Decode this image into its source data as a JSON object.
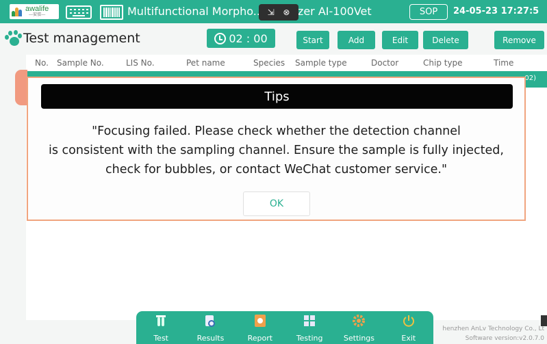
{
  "colors": {
    "accent": "#2ab091",
    "dialog_border": "#f0a47e",
    "dialog_header": "#050505",
    "scroll_tab": "#f19a80"
  },
  "titlebar": {
    "logo_text": "awalife",
    "logo_subtext": "—安驭—",
    "app_title": "Multifunctional Morpho... Analyzer AI-100Vet",
    "sop_label": "SOP",
    "datetime": "24-05-23 17:27:5"
  },
  "header": {
    "title": "Test management",
    "timer": "02 : 00",
    "buttons": {
      "start": "Start",
      "add": "Add",
      "edit": "Edit",
      "delete": "Delete",
      "remove": "Remove"
    }
  },
  "table": {
    "columns": [
      "No.",
      "Sample No.",
      "LIS No.",
      "Pet name",
      "Species",
      "Sample type",
      "Doctor",
      "Chip type",
      "Time"
    ],
    "selected_row_time_fragment": "02)"
  },
  "dialog": {
    "title": "Tips",
    "message_line1": "\"Focusing failed. Please check whether the detection channel",
    "message_line2": "is consistent with the sampling channel. Ensure the sample is fully injected,",
    "message_line3": "check for bubbles, or contact WeChat customer service.\"",
    "ok": "OK"
  },
  "nav": {
    "items": [
      {
        "label": "Test",
        "icon": "test-tube-icon"
      },
      {
        "label": "Results",
        "icon": "results-icon"
      },
      {
        "label": "Report",
        "icon": "report-icon"
      },
      {
        "label": "Testing",
        "icon": "testing-icon"
      },
      {
        "label": "Settings",
        "icon": "settings-gear-icon"
      },
      {
        "label": "Exit",
        "icon": "power-icon"
      }
    ]
  },
  "footer": {
    "company": "henzhen AnLv Technology Co., Lt",
    "version": "Software version:v2.0.7.0"
  }
}
